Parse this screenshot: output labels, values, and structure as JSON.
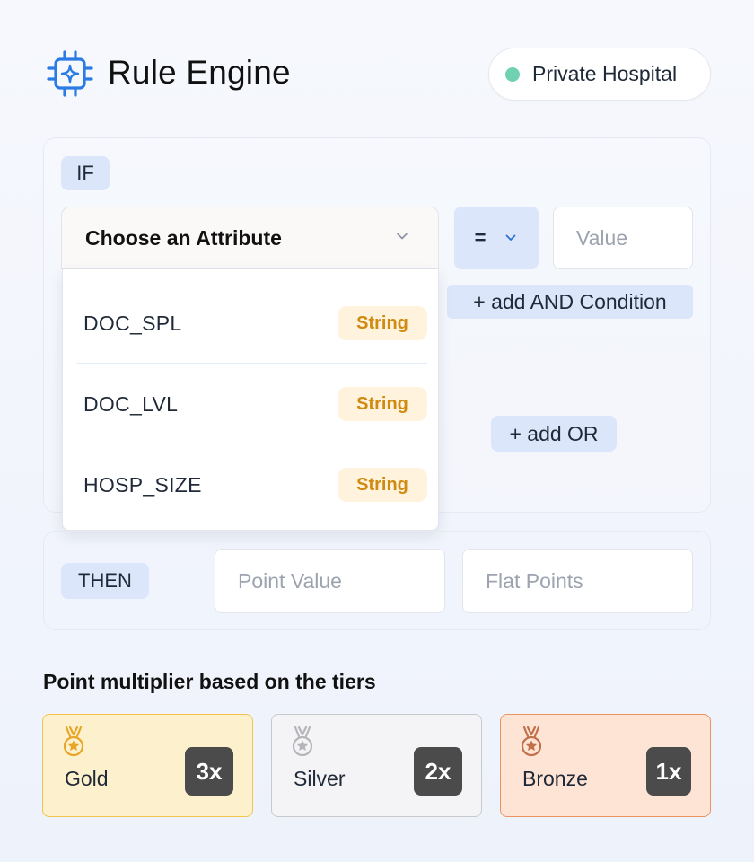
{
  "header": {
    "title": "Rule Engine",
    "logo_icon": "chip-sparkle-icon",
    "context_pill": {
      "label": "Private Hospital",
      "status_color": "#6fd1b2"
    }
  },
  "condition": {
    "if_label": "IF",
    "attribute_select": {
      "placeholder": "Choose an Attribute",
      "expanded": true
    },
    "operator": {
      "value": "="
    },
    "value_input": {
      "placeholder": "Value"
    },
    "add_and_label": "+ add AND Condition",
    "add_or_label": "+ add OR",
    "attribute_options": [
      {
        "name": "DOC_SPL",
        "type": "String"
      },
      {
        "name": "DOC_LVL",
        "type": "String"
      },
      {
        "name": "HOSP_SIZE",
        "type": "String"
      }
    ]
  },
  "action": {
    "then_label": "THEN",
    "point_value_placeholder": "Point Value",
    "flat_points_placeholder": "Flat Points"
  },
  "tiers": {
    "title": "Point multiplier based on the tiers",
    "items": [
      {
        "name": "Gold",
        "multiplier": "3x",
        "color": "#f3c34d"
      },
      {
        "name": "Silver",
        "multiplier": "2x",
        "color": "#b5b5ba"
      },
      {
        "name": "Bronze",
        "multiplier": "1x",
        "color": "#c2704a"
      }
    ]
  }
}
